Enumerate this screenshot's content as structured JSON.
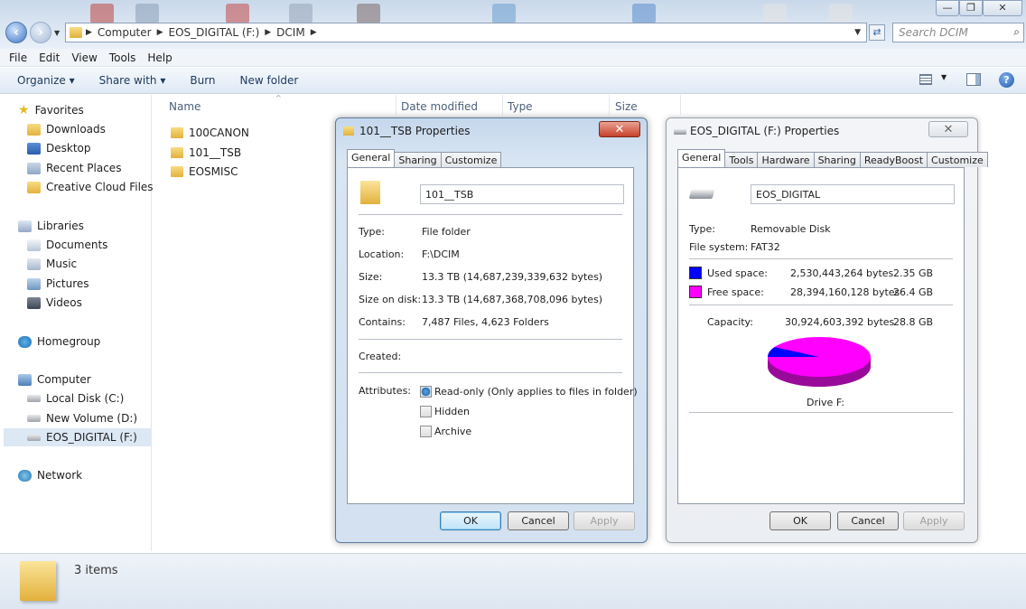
{
  "window": {
    "search_placeholder": "Search DCIM",
    "breadcrumb": [
      "Computer",
      "EOS_DIGITAL (F:)",
      "DCIM"
    ],
    "controls": {
      "minimize": "—",
      "maximize": "❐",
      "close": "✕"
    }
  },
  "menubar": [
    "File",
    "Edit",
    "View",
    "Tools",
    "Help"
  ],
  "commandbar": [
    "Organize ▾",
    "Share with ▾",
    "Burn",
    "New folder"
  ],
  "nav": {
    "favorites": "Favorites",
    "favorites_items": [
      "Downloads",
      "Desktop",
      "Recent Places",
      "Creative Cloud Files"
    ],
    "libraries": "Libraries",
    "libraries_items": [
      "Documents",
      "Music",
      "Pictures",
      "Videos"
    ],
    "homegroup": "Homegroup",
    "computer": "Computer",
    "computer_items": [
      "Local Disk (C:)",
      "New Volume (D:)",
      "EOS_DIGITAL (F:)"
    ],
    "network": "Network"
  },
  "columns": [
    "Name",
    "Date modified",
    "Type",
    "Size"
  ],
  "files": [
    "100CANON",
    "101__TSB",
    "EOSMISC"
  ],
  "status": {
    "count": "3 items"
  },
  "folder_dialog": {
    "title": "101__TSB Properties",
    "tabs": [
      "General",
      "Sharing",
      "Customize"
    ],
    "name": "101__TSB",
    "type_label": "Type:",
    "type_value": "File folder",
    "location_label": "Location:",
    "location_value": "F:\\DCIM",
    "size_label": "Size:",
    "size_value": "13.3 TB (14,687,239,339,632 bytes)",
    "size_disk_label": "Size on disk:",
    "size_disk_value": "13.3 TB (14,687,368,708,096 bytes)",
    "contains_label": "Contains:",
    "contains_value": "7,487 Files, 4,623 Folders",
    "created_label": "Created:",
    "attributes_label": "Attributes:",
    "readonly": "Read-only (Only applies to files in folder)",
    "hidden": "Hidden",
    "archive": "Archive",
    "ok": "OK",
    "cancel": "Cancel",
    "apply": "Apply"
  },
  "drive_dialog": {
    "title": "EOS_DIGITAL (F:) Properties",
    "tabs": [
      "General",
      "Tools",
      "Hardware",
      "Sharing",
      "ReadyBoost",
      "Customize"
    ],
    "name": "EOS_DIGITAL",
    "type_label": "Type:",
    "type_value": "Removable Disk",
    "fs_label": "File system:",
    "fs_value": "FAT32",
    "used_label": "Used space:",
    "used_bytes": "2,530,443,264 bytes",
    "used_gb": "2.35 GB",
    "free_label": "Free space:",
    "free_bytes": "28,394,160,128 bytes",
    "free_gb": "26.4 GB",
    "capacity_label": "Capacity:",
    "capacity_bytes": "30,924,603,392 bytes",
    "capacity_gb": "28.8 GB",
    "drive_label": "Drive F:",
    "used_fraction": 0.082,
    "used_color": "#0000ff",
    "free_color": "#ff00ff",
    "ok": "OK",
    "cancel": "Cancel",
    "apply": "Apply"
  }
}
